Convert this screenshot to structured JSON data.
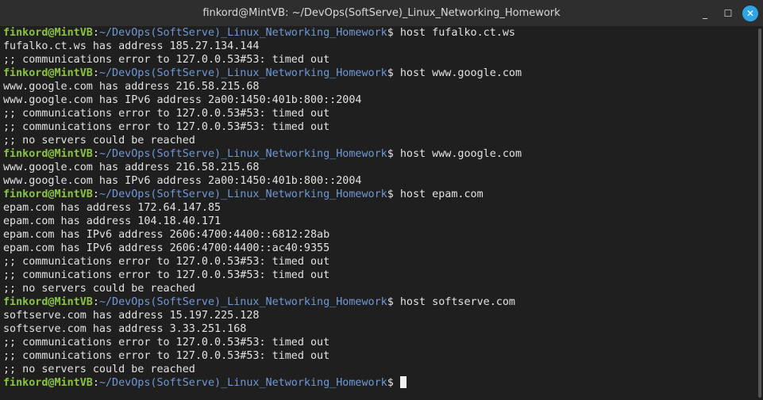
{
  "window": {
    "title": "finkord@MintVB: ~/DevOps(SoftServe)_Linux_Networking_Homework",
    "minimize": "_",
    "maximize": "☐",
    "close": "✕"
  },
  "prompt": {
    "user": "finkord@MintVB",
    "sep": ":",
    "path": "~/DevOps(SoftServe)_Linux_Networking_Homework",
    "symbol": "$"
  },
  "lines": [
    {
      "type": "cmd",
      "text": " host fufalko.ct.ws"
    },
    {
      "type": "out",
      "text": "fufalko.ct.ws has address 185.27.134.144"
    },
    {
      "type": "out",
      "text": ";; communications error to 127.0.0.53#53: timed out"
    },
    {
      "type": "cmd",
      "text": " host www.google.com"
    },
    {
      "type": "out",
      "text": "www.google.com has address 216.58.215.68"
    },
    {
      "type": "out",
      "text": "www.google.com has IPv6 address 2a00:1450:401b:800::2004"
    },
    {
      "type": "out",
      "text": ";; communications error to 127.0.0.53#53: timed out"
    },
    {
      "type": "out",
      "text": ";; communications error to 127.0.0.53#53: timed out"
    },
    {
      "type": "out",
      "text": ";; no servers could be reached"
    },
    {
      "type": "cmd",
      "text": " host www.google.com"
    },
    {
      "type": "out",
      "text": "www.google.com has address 216.58.215.68"
    },
    {
      "type": "out",
      "text": "www.google.com has IPv6 address 2a00:1450:401b:800::2004"
    },
    {
      "type": "cmd",
      "text": " host epam.com"
    },
    {
      "type": "out",
      "text": "epam.com has address 172.64.147.85"
    },
    {
      "type": "out",
      "text": "epam.com has address 104.18.40.171"
    },
    {
      "type": "out",
      "text": "epam.com has IPv6 address 2606:4700:4400::6812:28ab"
    },
    {
      "type": "out",
      "text": "epam.com has IPv6 address 2606:4700:4400::ac40:9355"
    },
    {
      "type": "out",
      "text": ";; communications error to 127.0.0.53#53: timed out"
    },
    {
      "type": "out",
      "text": ";; communications error to 127.0.0.53#53: timed out"
    },
    {
      "type": "out",
      "text": ";; no servers could be reached"
    },
    {
      "type": "cmd",
      "text": " host softserve.com"
    },
    {
      "type": "out",
      "text": "softserve.com has address 15.197.225.128"
    },
    {
      "type": "out",
      "text": "softserve.com has address 3.33.251.168"
    },
    {
      "type": "out",
      "text": ";; communications error to 127.0.0.53#53: timed out"
    },
    {
      "type": "out",
      "text": ";; communications error to 127.0.0.53#53: timed out"
    },
    {
      "type": "out",
      "text": ";; no servers could be reached"
    },
    {
      "type": "cmd",
      "text": " "
    }
  ]
}
